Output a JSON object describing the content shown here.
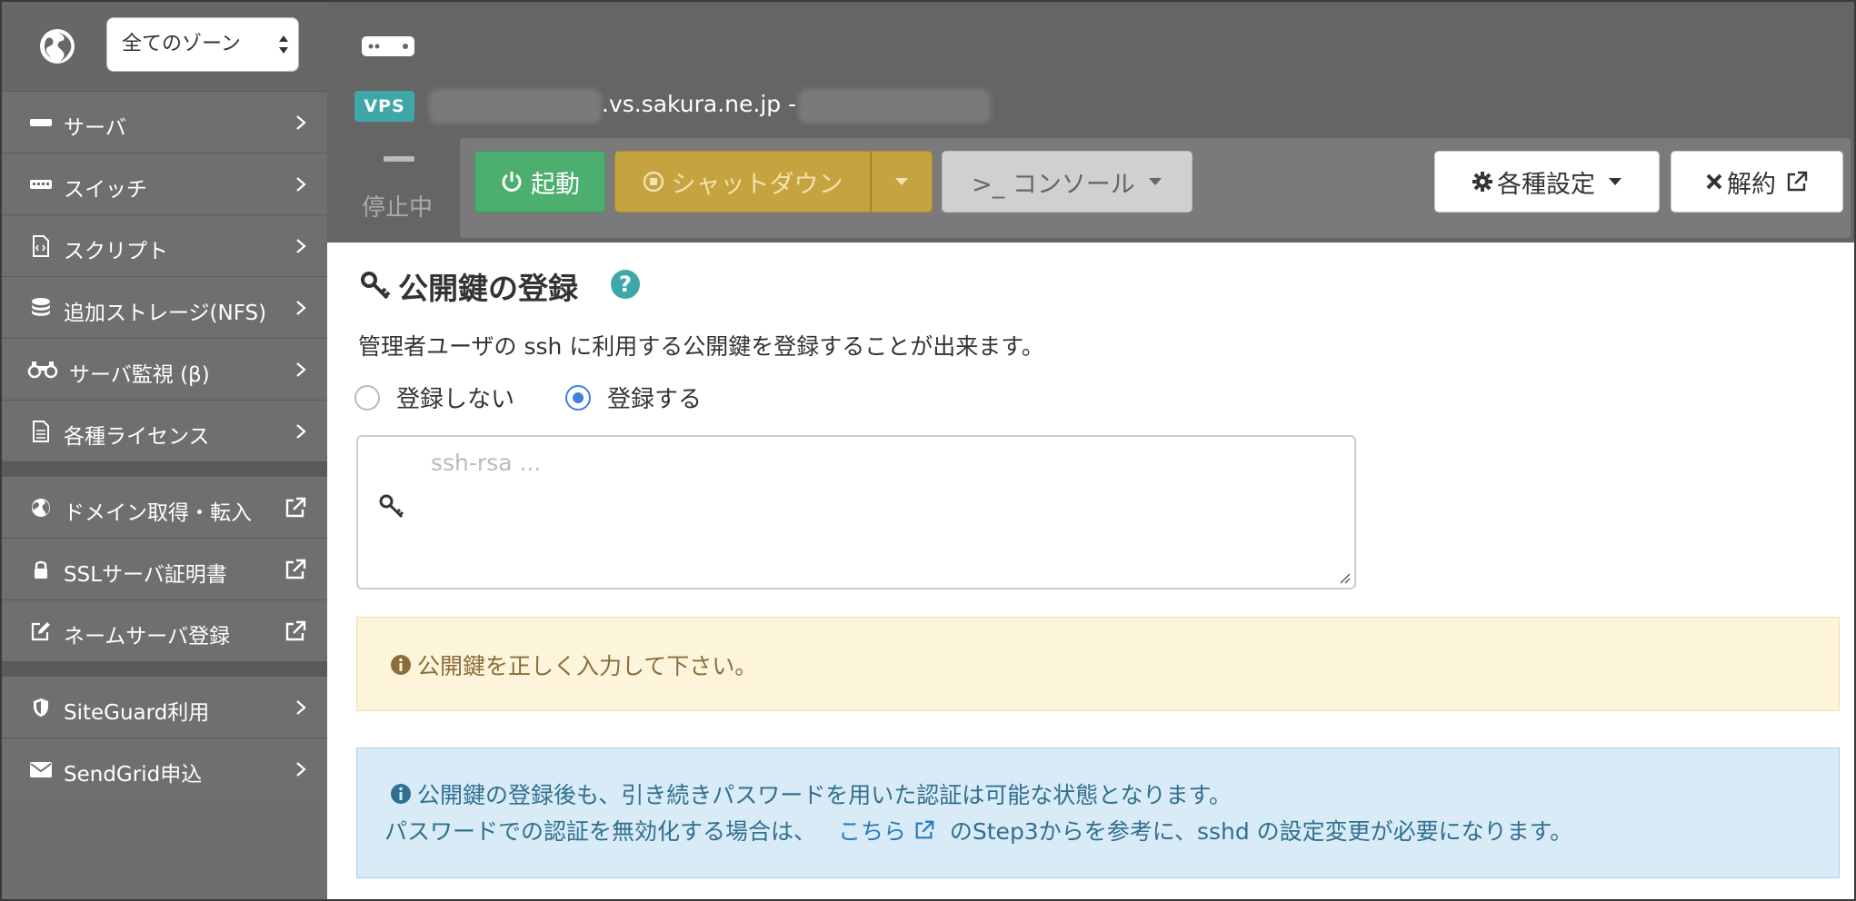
{
  "zone_select": {
    "value": "全てのゾーン"
  },
  "sidebar": {
    "items": [
      {
        "label": "サーバ",
        "icon": "server-icon"
      },
      {
        "label": "スイッチ",
        "icon": "switch-icon"
      },
      {
        "label": "スクリプト",
        "icon": "script-icon"
      },
      {
        "label": "追加ストレージ(NFS)",
        "icon": "database-icon"
      },
      {
        "label": "サーバ監視 (β)",
        "icon": "binoculars-icon"
      },
      {
        "label": "各種ライセンス",
        "icon": "document-icon"
      }
    ],
    "external_items": [
      {
        "label": "ドメイン取得・転入",
        "icon": "globe-icon"
      },
      {
        "label": "SSLサーバ証明書",
        "icon": "lock-icon"
      },
      {
        "label": "ネームサーバ登録",
        "icon": "edit-icon"
      }
    ],
    "extra_items": [
      {
        "label": "SiteGuard利用",
        "icon": "shield-icon"
      },
      {
        "label": "SendGrid申込",
        "icon": "envelope-icon"
      }
    ]
  },
  "header": {
    "badge": "VPS",
    "hostname": ".vs.sakura.ne.jp -",
    "status": "停止中",
    "buttons": {
      "start": "起動",
      "shutdown": "シャットダウン",
      "console": ">_ コンソール",
      "settings": "各種設定",
      "cancel": "解約"
    }
  },
  "main": {
    "title": "公開鍵の登録",
    "help": "?",
    "description": "管理者ユーザの ssh に利用する公開鍵を登録することが出来ます。",
    "radio_no": "登録しない",
    "radio_yes": "登録する",
    "radio_selected": "登録する",
    "key_placeholder": "ssh-rsa ...",
    "warning": "公開鍵を正しく入力して下さい。",
    "info_line1": "公開鍵の登録後も、引き続きパスワードを用いた認証は可能な状態となります。",
    "info_line2_pre": "パスワードでの認証を無効化する場合は、",
    "info_link": "こちら",
    "info_line2_post": "のStep3からを参考に、sshd の設定変更が必要になります。"
  },
  "colors": {
    "sidebar_bg": "#6f6f6f",
    "header_bg": "#656565",
    "start_green": "#4caf6f",
    "shutdown_gold": "#c5a33e",
    "vps_teal": "#3fa7a8",
    "warning_bg": "#fcf5dc",
    "info_bg": "#d9ebf6",
    "radio_blue": "#3b82e0"
  }
}
